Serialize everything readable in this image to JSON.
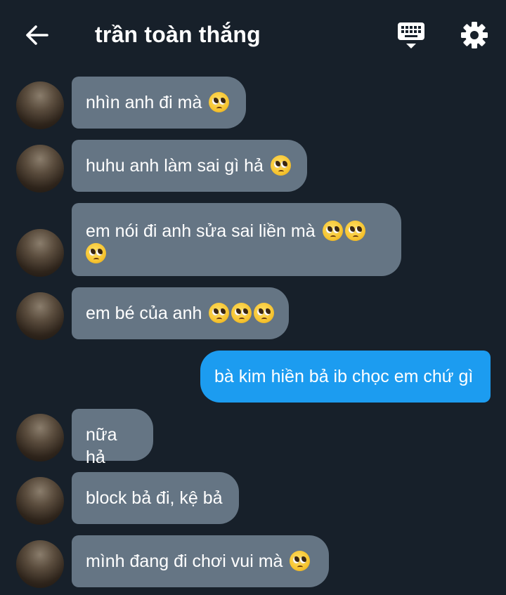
{
  "header": {
    "title": "trần toàn thắng",
    "back_icon": "arrow-left-icon",
    "keyboard_icon": "keyboard-icon",
    "settings_icon": "gear-icon"
  },
  "colors": {
    "background": "#17202a",
    "incoming_bubble": "#657584",
    "outgoing_bubble": "#1c9cf0",
    "text": "#ffffff"
  },
  "messages": [
    {
      "direction": "incoming",
      "text": "nhìn anh đi mà",
      "emoji_count": 1
    },
    {
      "direction": "incoming",
      "text": "huhu anh làm sai gì hả",
      "emoji_count": 1
    },
    {
      "direction": "incoming",
      "text": "em nói đi anh sửa sai liền mà",
      "emoji_count": 3
    },
    {
      "direction": "incoming",
      "text": "em bé của anh",
      "emoji_count": 3
    },
    {
      "direction": "outgoing",
      "text": "bà kim hiền bả ib chọc em chứ gì",
      "emoji_count": 0
    },
    {
      "direction": "incoming",
      "text": "nữa hả",
      "emoji_count": 0
    },
    {
      "direction": "incoming",
      "text": "block bả đi, kệ bả",
      "emoji_count": 0
    },
    {
      "direction": "incoming",
      "text": "mình đang đi chơi vui mà",
      "emoji_count": 1
    }
  ]
}
